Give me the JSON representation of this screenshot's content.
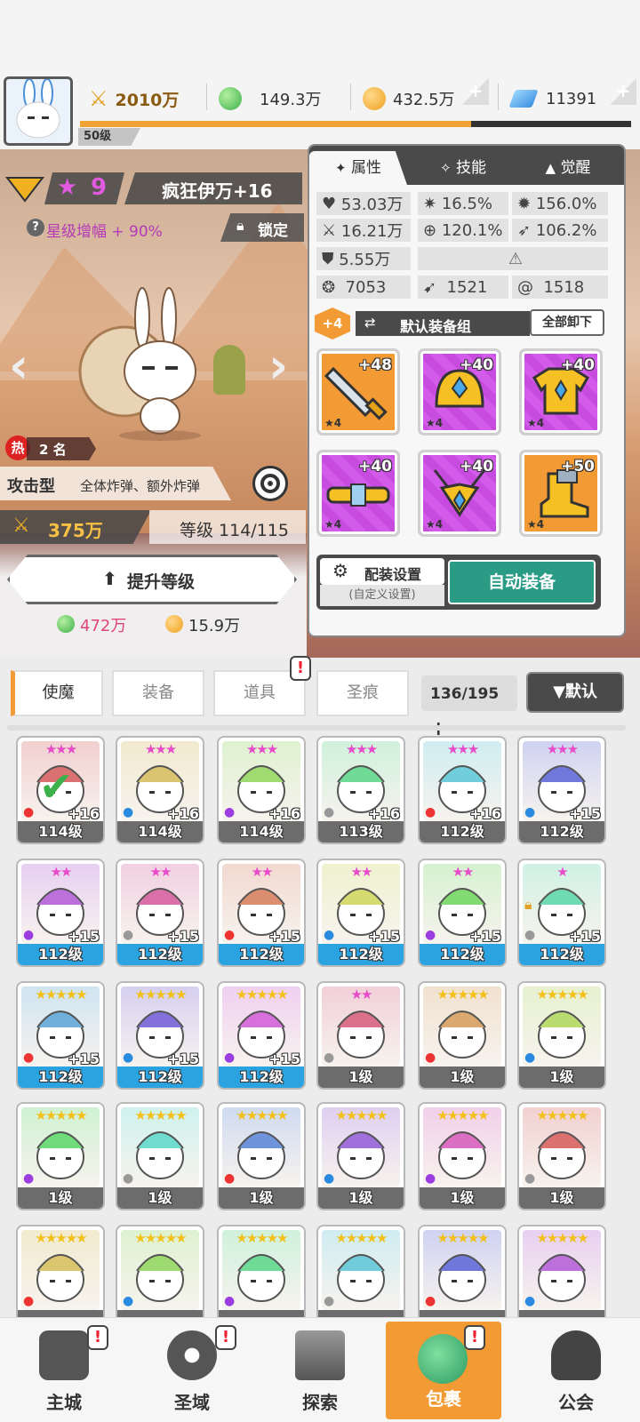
{
  "topbar": {
    "player_level": "50级",
    "power": "2010万",
    "green_gem": "149.3万",
    "gold": "432.5万",
    "diamond": "11391",
    "xp_progress": 0.71
  },
  "hero": {
    "star_count": "9",
    "name": "疯狂伊万+16",
    "star_bonus": "星级增幅 + 90%",
    "lock_label": "锁定",
    "hot_rank_label": "热",
    "rank": "2 名",
    "type": "攻击型",
    "skill_desc": "全体炸弹、额外炸弹",
    "power": "375万",
    "level": "等级 114/115",
    "upgrade_button": "提升等级",
    "cost_green": "472万",
    "cost_gold": "15.9万"
  },
  "panel": {
    "tabs": [
      {
        "label": "属性",
        "icon": "attribute-icon"
      },
      {
        "label": "技能",
        "icon": "skill-icon"
      },
      {
        "label": "觉醒",
        "icon": "awaken-icon"
      }
    ],
    "stats": {
      "hp": "53.03万",
      "crit": "16.5%",
      "crit_dmg": "156.0%",
      "attack": "16.21万",
      "accuracy": "120.1%",
      "speed": "106.2%",
      "defense": "5.55万",
      "s1": "7053",
      "s2": "1521",
      "s3": "1518"
    },
    "equip_plus": "+4",
    "equip_set": "默认装备组",
    "unequip_all": "全部卸下",
    "equipment": [
      {
        "name": "sword",
        "level": "+48",
        "stars": "★4",
        "rarity": "orange"
      },
      {
        "name": "helmet",
        "level": "+40",
        "stars": "★4",
        "rarity": "purple"
      },
      {
        "name": "armor",
        "level": "+40",
        "stars": "★4",
        "rarity": "purple"
      },
      {
        "name": "belt",
        "level": "+40",
        "stars": "★4",
        "rarity": "purple"
      },
      {
        "name": "necklace",
        "level": "+40",
        "stars": "★4",
        "rarity": "purple"
      },
      {
        "name": "boots",
        "level": "+50",
        "stars": "★4",
        "rarity": "orange"
      }
    ],
    "config_button": "配装设置",
    "config_sub": "(自定义设置)",
    "auto_equip": "自动装备"
  },
  "inventory": {
    "tabs": [
      "使魔",
      "装备",
      "道具",
      "圣痕"
    ],
    "count": "136/195",
    "sort_button": "▼默认"
  },
  "cards": [
    {
      "level": "114级",
      "plus": "+16",
      "stars": "★★★",
      "color": "gray"
    },
    {
      "level": "114级",
      "plus": "+16",
      "stars": "★★★",
      "color": "gray"
    },
    {
      "level": "114级",
      "plus": "+16",
      "stars": "★★★",
      "color": "gray"
    },
    {
      "level": "113级",
      "plus": "+16",
      "stars": "★★★",
      "color": "gray"
    },
    {
      "level": "112级",
      "plus": "+16",
      "stars": "★★★",
      "color": "gray"
    },
    {
      "level": "112级",
      "plus": "+15",
      "stars": "★★★",
      "color": "gray"
    },
    {
      "level": "112级",
      "plus": "+15",
      "stars": "★★",
      "color": "blue"
    },
    {
      "level": "112级",
      "plus": "+15",
      "stars": "★★",
      "color": "blue"
    },
    {
      "level": "112级",
      "plus": "+15",
      "stars": "★★",
      "color": "blue"
    },
    {
      "level": "112级",
      "plus": "+15",
      "stars": "★★",
      "color": "blue"
    },
    {
      "level": "112级",
      "plus": "+15",
      "stars": "★★",
      "color": "blue"
    },
    {
      "level": "112级",
      "plus": "+15",
      "stars": "★",
      "color": "blue"
    },
    {
      "level": "112级",
      "plus": "+15",
      "stars": "★★★★★",
      "color": "blue"
    },
    {
      "level": "112级",
      "plus": "+15",
      "stars": "★★★★★",
      "color": "blue"
    },
    {
      "level": "112级",
      "plus": "+15",
      "stars": "★★★★★",
      "color": "blue"
    },
    {
      "level": "1级",
      "plus": "",
      "stars": "★★",
      "color": "gray"
    },
    {
      "level": "1级",
      "plus": "",
      "stars": "★★★★★",
      "color": "gray"
    },
    {
      "level": "1级",
      "plus": "",
      "stars": "★★★★★",
      "color": "gray"
    },
    {
      "level": "1级",
      "plus": "",
      "stars": "★★★★★",
      "color": "gray"
    },
    {
      "level": "1级",
      "plus": "",
      "stars": "★★★★★",
      "color": "gray"
    },
    {
      "level": "1级",
      "plus": "",
      "stars": "★★★★★",
      "color": "gray"
    },
    {
      "level": "1级",
      "plus": "",
      "stars": "★★★★★",
      "color": "gray"
    },
    {
      "level": "1级",
      "plus": "",
      "stars": "★★★★★",
      "color": "gray"
    },
    {
      "level": "1级",
      "plus": "",
      "stars": "★★★★★",
      "color": "gray"
    },
    {
      "level": "",
      "plus": "",
      "stars": "★★★★★",
      "color": "gray"
    },
    {
      "level": "",
      "plus": "",
      "stars": "★★★★★",
      "color": "gray"
    },
    {
      "level": "",
      "plus": "",
      "stars": "★★★★★",
      "color": "gray"
    },
    {
      "level": "",
      "plus": "",
      "stars": "★★★★★",
      "color": "gray"
    },
    {
      "level": "",
      "plus": "",
      "stars": "★★★★★",
      "color": "gray"
    },
    {
      "level": "",
      "plus": "",
      "stars": "★★★★★",
      "color": "gray"
    }
  ],
  "nav": [
    {
      "label": "主城",
      "alert": true
    },
    {
      "label": "圣域",
      "alert": true
    },
    {
      "label": "探索",
      "alert": false
    },
    {
      "label": "包裹",
      "alert": true,
      "active": true
    },
    {
      "label": "公会",
      "alert": false
    }
  ],
  "colors": {
    "accent_orange": "#f29a33",
    "accent_teal": "#2a9c86",
    "purple_item": "#c84be0"
  }
}
